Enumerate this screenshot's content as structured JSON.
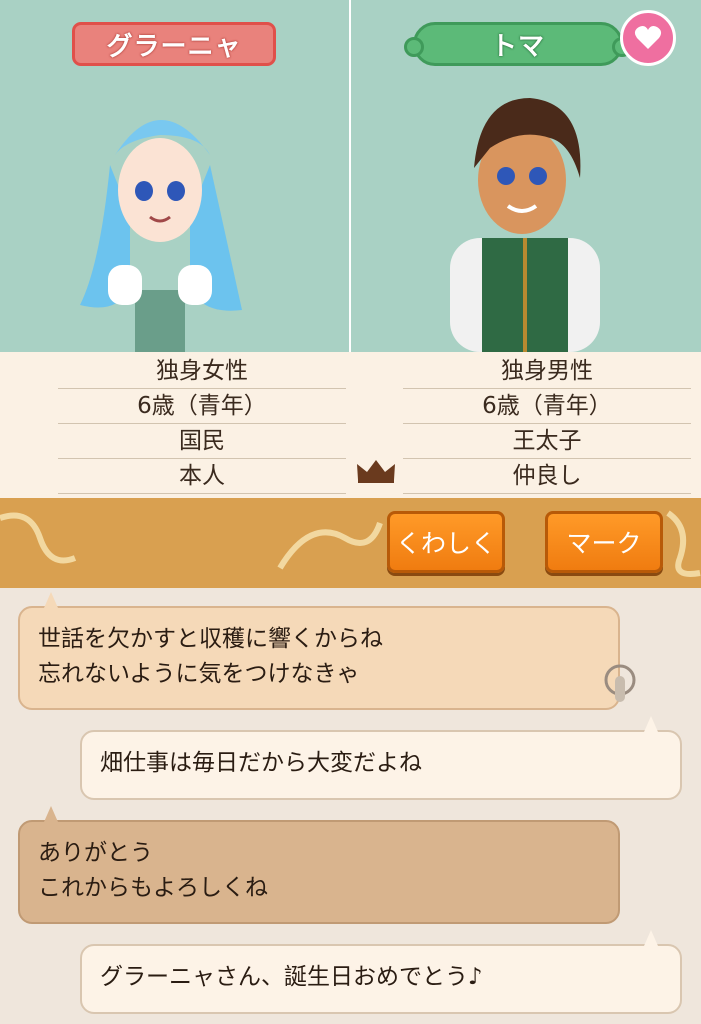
{
  "left": {
    "name": "グラーニャ",
    "info": [
      "独身女性",
      "6歳（青年）",
      "国民",
      "本人"
    ]
  },
  "right": {
    "name": "トマ",
    "info": [
      "独身男性",
      "6歳（青年）",
      "王太子",
      "仲良し"
    ]
  },
  "buttons": {
    "details": "くわしく",
    "mark": "マーク"
  },
  "chat": [
    {
      "speaker": "left",
      "text": "世話を欠かすと収穫に響くからね\n忘れないように気をつけなきゃ"
    },
    {
      "speaker": "right",
      "text": "畑仕事は毎日だから大変だよね"
    },
    {
      "speaker": "left",
      "text": "ありがとう\nこれからもよろしくね"
    },
    {
      "speaker": "right",
      "text": "グラーニャさん、誕生日おめでとう♪"
    }
  ],
  "icons": {
    "heart": "heart-icon",
    "crown": "crown-icon",
    "tap": "tap-hand-icon"
  },
  "colors": {
    "left_name_bg": "#e9827c",
    "right_name_bg": "#5cba78",
    "button_orange": "#f08a1a",
    "heart_pink": "#ef6fa0"
  }
}
